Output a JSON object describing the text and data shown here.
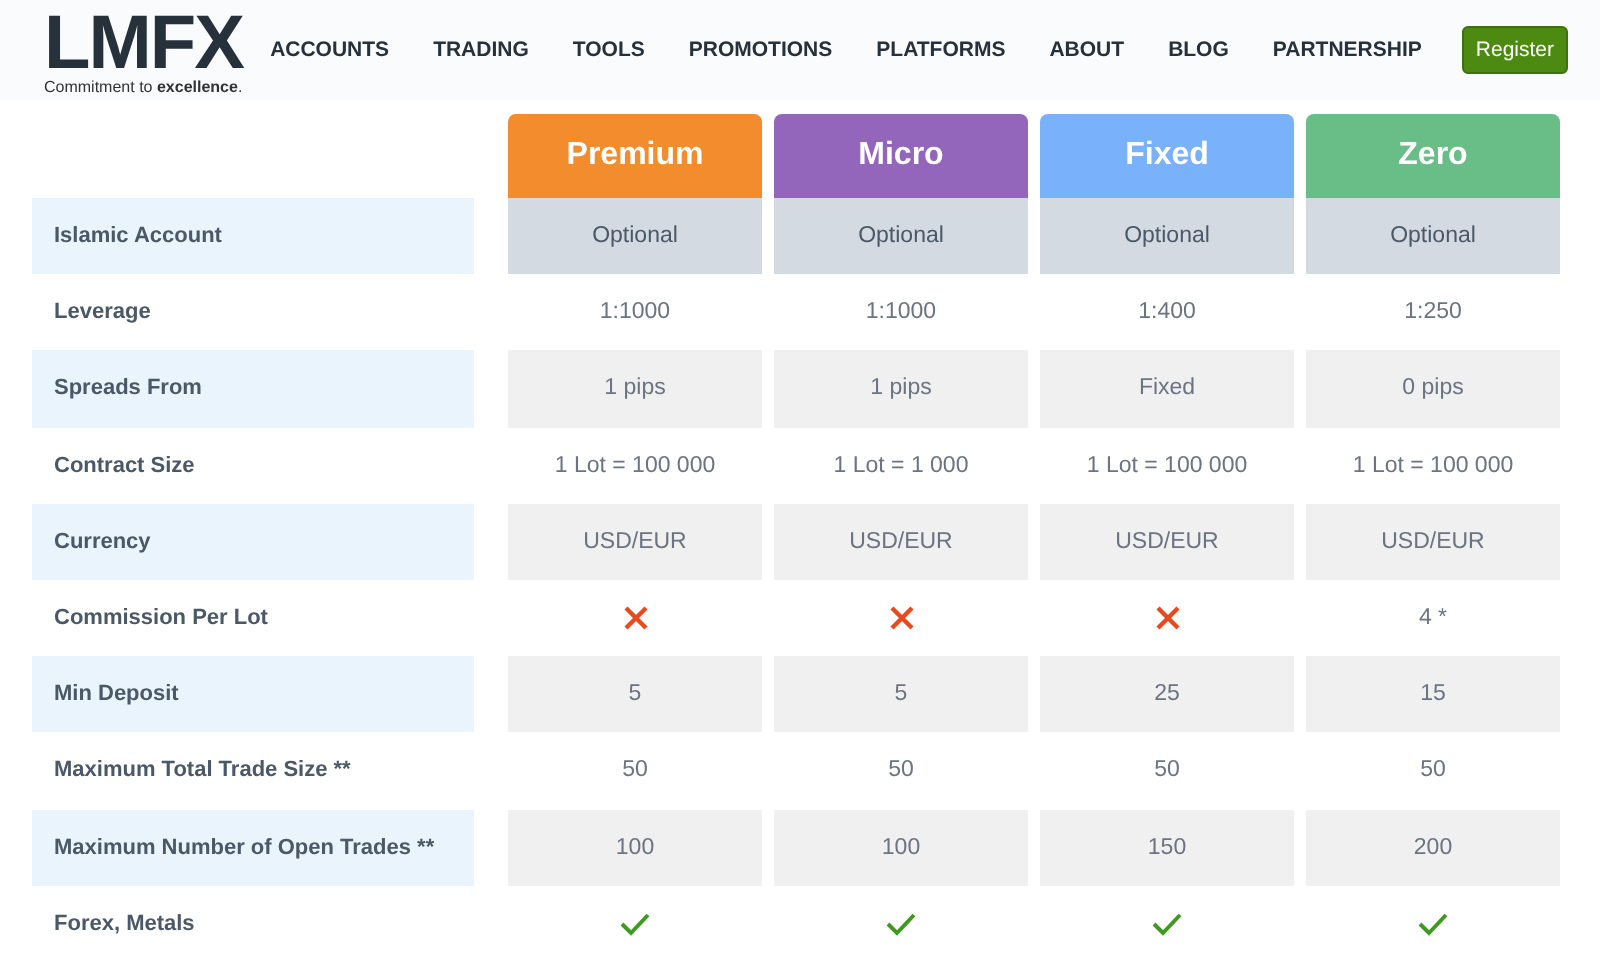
{
  "logo": {
    "text": "LMFX",
    "tagline": "Commitment to **excellence**."
  },
  "nav": {
    "items": [
      "ACCOUNTS",
      "TRADING",
      "TOOLS",
      "PROMOTIONS",
      "PLATFORMS",
      "ABOUT",
      "BLOG",
      "PARTNERSHIP"
    ],
    "button": "Register"
  },
  "plans": [
    {
      "name": "Premium",
      "color": "#f28c2c"
    },
    {
      "name": "Micro",
      "color": "#9365bb"
    },
    {
      "name": "Fixed",
      "color": "#79b1fb"
    },
    {
      "name": "Zero",
      "color": "#69bd86"
    }
  ],
  "rows": [
    {
      "label": "Islamic Account",
      "highlighted": true,
      "cells": [
        {
          "kind": "text",
          "text": "Optional"
        },
        {
          "kind": "text",
          "text": "Optional"
        },
        {
          "kind": "text",
          "text": "Optional"
        },
        {
          "kind": "text",
          "text": "Optional"
        }
      ]
    },
    {
      "label": "Leverage",
      "highlighted": false,
      "cells": [
        {
          "kind": "text",
          "text": "1:1000"
        },
        {
          "kind": "text",
          "text": "1:1000"
        },
        {
          "kind": "text",
          "text": "1:400"
        },
        {
          "kind": "text",
          "text": "1:250"
        }
      ]
    },
    {
      "label": "Spreads From",
      "highlighted": false,
      "cells": [
        {
          "kind": "text",
          "text": "1 pips"
        },
        {
          "kind": "text",
          "text": "1 pips"
        },
        {
          "kind": "text",
          "text": "Fixed"
        },
        {
          "kind": "text",
          "text": "0 pips"
        }
      ]
    },
    {
      "label": "Contract Size",
      "highlighted": false,
      "cells": [
        {
          "kind": "text",
          "text": "1 Lot = 100 000"
        },
        {
          "kind": "text",
          "text": "1 Lot = 1 000"
        },
        {
          "kind": "text",
          "text": "1 Lot = 100 000"
        },
        {
          "kind": "text",
          "text": "1 Lot = 100 000"
        }
      ]
    },
    {
      "label": "Currency",
      "highlighted": false,
      "cells": [
        {
          "kind": "text",
          "text": "USD/EUR"
        },
        {
          "kind": "text",
          "text": "USD/EUR"
        },
        {
          "kind": "text",
          "text": "USD/EUR"
        },
        {
          "kind": "text",
          "text": "USD/EUR"
        }
      ]
    },
    {
      "label": "Commission Per Lot",
      "highlighted": false,
      "cells": [
        {
          "kind": "cross"
        },
        {
          "kind": "cross"
        },
        {
          "kind": "cross"
        },
        {
          "kind": "text",
          "text": "4 *"
        }
      ]
    },
    {
      "label": "Min Deposit",
      "highlighted": false,
      "cells": [
        {
          "kind": "text",
          "text": "5"
        },
        {
          "kind": "text",
          "text": "5"
        },
        {
          "kind": "text",
          "text": "25"
        },
        {
          "kind": "text",
          "text": "15"
        }
      ]
    },
    {
      "label": "Maximum Total Trade Size **",
      "highlighted": false,
      "cells": [
        {
          "kind": "text",
          "text": "50"
        },
        {
          "kind": "text",
          "text": "50"
        },
        {
          "kind": "text",
          "text": "50"
        },
        {
          "kind": "text",
          "text": "50"
        }
      ]
    },
    {
      "label": "Maximum Number of Open Trades **",
      "highlighted": false,
      "cells": [
        {
          "kind": "text",
          "text": "100"
        },
        {
          "kind": "text",
          "text": "100"
        },
        {
          "kind": "text",
          "text": "150"
        },
        {
          "kind": "text",
          "text": "200"
        }
      ]
    },
    {
      "label": "Forex, Metals",
      "highlighted": false,
      "cells": [
        {
          "kind": "check"
        },
        {
          "kind": "check"
        },
        {
          "kind": "check"
        },
        {
          "kind": "check"
        }
      ]
    }
  ]
}
